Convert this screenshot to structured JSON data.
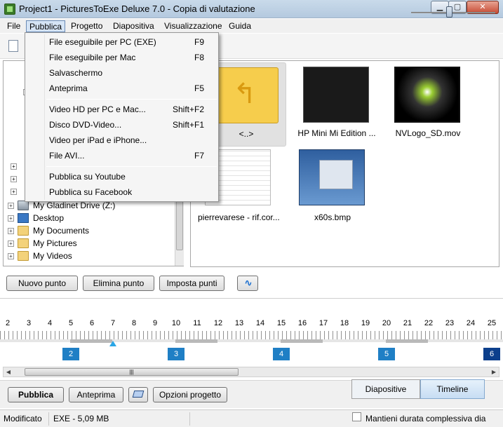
{
  "window": {
    "title": "Project1 - PicturesToExe Deluxe 7.0 - Copia di valutazione",
    "min": "▁",
    "max": "▢",
    "close": "✕"
  },
  "menubar": [
    "File",
    "Pubblica",
    "Progetto",
    "Diapositiva",
    "Visualizzazione",
    "Guida"
  ],
  "publish_menu": {
    "items": [
      {
        "label": "File eseguibile per PC (EXE)",
        "shortcut": "F9"
      },
      {
        "label": "File eseguibile per Mac",
        "shortcut": "F8"
      },
      {
        "label": "Salvaschermo",
        "shortcut": ""
      },
      {
        "label": "Anteprima",
        "shortcut": "F5"
      },
      {
        "label": "Video HD per PC e Mac...",
        "shortcut": "Shift+F2"
      },
      {
        "label": "Disco DVD-Video...",
        "shortcut": "Shift+F1"
      },
      {
        "label": "Video per iPad e iPhone...",
        "shortcut": ""
      },
      {
        "label": "File AVI...",
        "shortcut": "F7"
      },
      {
        "label": "Pubblica su Youtube",
        "shortcut": ""
      },
      {
        "label": "Pubblica su Facebook",
        "shortcut": ""
      }
    ]
  },
  "tree": [
    {
      "label": "My Gladinet Drive (Z:)",
      "icon": "network-drive-icon"
    },
    {
      "label": "Desktop",
      "icon": "desktop-icon"
    },
    {
      "label": "My Documents",
      "icon": "folder-icon"
    },
    {
      "label": "My Pictures",
      "icon": "folder-icon"
    },
    {
      "label": "My Videos",
      "icon": "folder-icon"
    }
  ],
  "thumbnails": [
    {
      "caption": "<..>"
    },
    {
      "caption": "HP Mini Mi Edition ..."
    },
    {
      "caption": "NVLogo_SD.mov"
    },
    {
      "caption": "pierrevarese - rif.cor..."
    },
    {
      "caption": "x60s.bmp"
    }
  ],
  "keypoint_buttons": {
    "new": "Nuovo punto",
    "delete": "Elimina punto",
    "set": "Imposta punti",
    "wave_icon": "∿"
  },
  "ruler": {
    "labels": [
      "2",
      "3",
      "4",
      "5",
      "6",
      "7",
      "8",
      "9",
      "10",
      "11",
      "12",
      "13",
      "14",
      "15",
      "16",
      "17",
      "18",
      "19",
      "20",
      "21",
      "22",
      "23",
      "24",
      "25"
    ],
    "cursor_value": 7
  },
  "slides": [
    {
      "label": "2",
      "at": 5
    },
    {
      "label": "3",
      "at": 10
    },
    {
      "label": "4",
      "at": 15
    },
    {
      "label": "5",
      "at": 20
    },
    {
      "label": "6",
      "at": 25
    }
  ],
  "bottom_buttons": {
    "publish": "Pubblica",
    "preview": "Anteprima",
    "options": "Opzioni progetto"
  },
  "tabs": {
    "slides": "Diapositive",
    "timeline": "Timeline"
  },
  "status": {
    "state": "Modificato",
    "size": "EXE - 5,09 MB",
    "keep_duration": "Mantieni durata complessiva dia"
  },
  "colors": {
    "slide_marker": "#1f7fc5",
    "cursor": "#2aa6e6"
  }
}
